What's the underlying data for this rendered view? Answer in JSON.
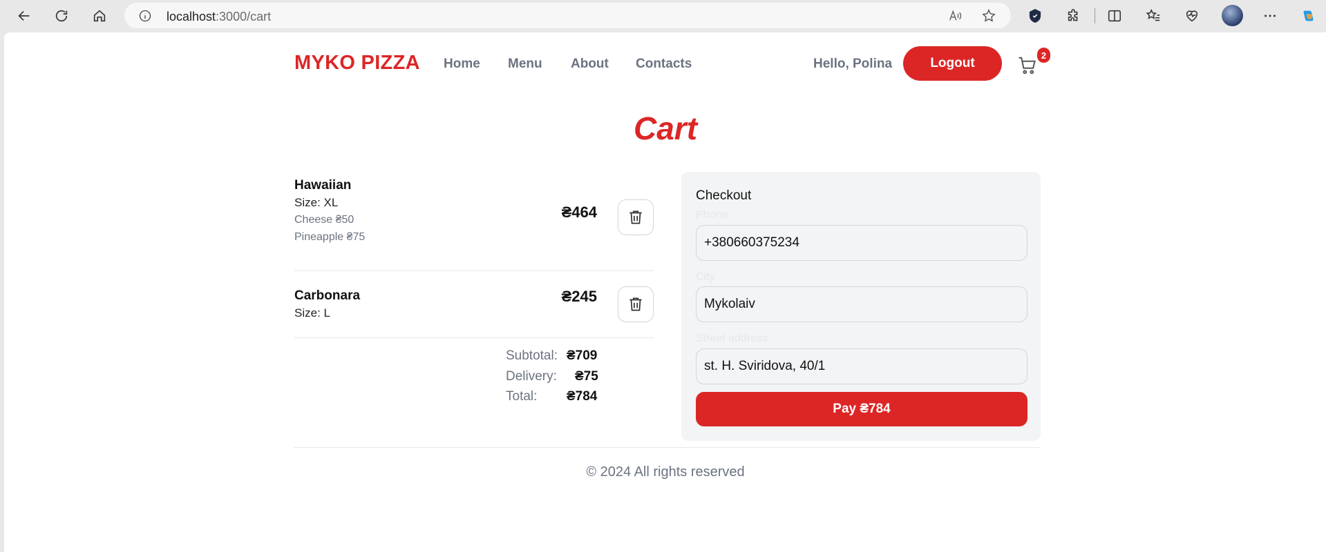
{
  "browser": {
    "url_host": "localhost",
    "url_path": ":3000/cart"
  },
  "header": {
    "logo": "MYKO PIZZA",
    "nav": [
      "Home",
      "Menu",
      "About",
      "Contacts"
    ],
    "greeting": "Hello, Polina",
    "logout_label": "Logout",
    "cart_count": "2"
  },
  "page": {
    "title": "Cart"
  },
  "cart": {
    "items": [
      {
        "name": "Hawaiian",
        "size": "Size: XL",
        "toppings": [
          "Cheese ₴50",
          "Pineapple ₴75"
        ],
        "price": "₴464"
      },
      {
        "name": "Carbonara",
        "size": "Size: L",
        "toppings": [],
        "price": "₴245"
      }
    ],
    "summary": {
      "subtotal_label": "Subtotal:",
      "subtotal_value": "₴709",
      "delivery_label": "Delivery:",
      "delivery_value": "₴75",
      "total_label": "Total:",
      "total_value": "₴784"
    }
  },
  "checkout": {
    "title": "Checkout",
    "phone_label": "Phone",
    "phone_value": "+380660375234",
    "city_label": "City",
    "city_value": "Mykolaiv",
    "street_label": "Street address",
    "street_value": "st. H. Sviridova, 40/1",
    "pay_label": "Pay ₴784"
  },
  "footer": {
    "text": "© 2024 All rights reserved"
  },
  "colors": {
    "accent": "#dc2626",
    "muted": "#6b7280",
    "panel": "#f3f4f6"
  }
}
